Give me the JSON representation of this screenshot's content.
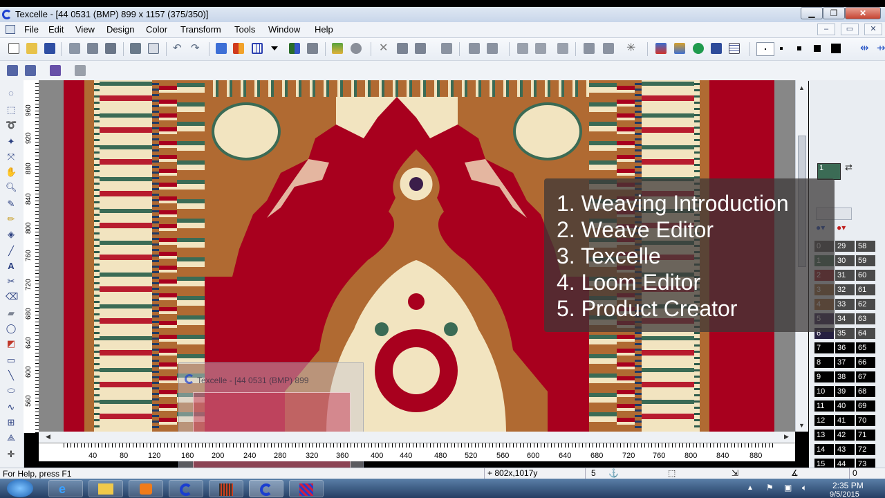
{
  "window": {
    "title": "Texcelle - [44 0531 (BMP) 899 x 1157 (375/350)]",
    "min_label": "▁",
    "restore_label": "❐",
    "close_label": "✕"
  },
  "menu": [
    "File",
    "Edit",
    "View",
    "Design",
    "Color",
    "Transform",
    "Tools",
    "Window",
    "Help"
  ],
  "mdi_controls": [
    "–",
    "▭",
    "✕"
  ],
  "vruler_labels": [
    "960",
    "920",
    "880",
    "840",
    "800",
    "760",
    "720",
    "680",
    "640",
    "600",
    "560"
  ],
  "hruler_labels": [
    "40",
    "80",
    "120",
    "160",
    "200",
    "240",
    "280",
    "320",
    "360",
    "400",
    "440",
    "480",
    "520",
    "560",
    "600",
    "640",
    "680",
    "720",
    "760",
    "800",
    "840",
    "880"
  ],
  "overlay_items": [
    "1. Weaving Introduction",
    "2. Weave Editor",
    "3. Texcelle",
    "4. Loom Editor",
    "5. Product Creator"
  ],
  "thumbnail": {
    "title": "Texcelle - [44 0531 (BMP) 899"
  },
  "palette": {
    "swatch_label": "1",
    "col1": [
      "0",
      "1",
      "2",
      "3",
      "4",
      "5",
      "6",
      "7",
      "8",
      "9",
      "10",
      "11",
      "12",
      "13",
      "14",
      "15"
    ],
    "col2": [
      "29",
      "30",
      "31",
      "32",
      "33",
      "34",
      "35",
      "36",
      "37",
      "38",
      "39",
      "40",
      "41",
      "42",
      "43",
      "44"
    ],
    "col3": [
      "58",
      "59",
      "60",
      "61",
      "62",
      "63",
      "64",
      "65",
      "66",
      "67",
      "68",
      "69",
      "70",
      "71",
      "72",
      "73"
    ],
    "colors": [
      "#5b5b5b",
      "#4e7a60",
      "#a0202a",
      "#a4703e",
      "#a56b3b",
      "#3a2d5a",
      "#262041",
      "#000000",
      "#000000",
      "#000000",
      "#000000",
      "#000000",
      "#000000",
      "#000000",
      "#000000",
      "#000000"
    ]
  },
  "status": {
    "help": "For Help, press F1",
    "coords": "+ 802x,1017y",
    "value": "5",
    "right_value": "0"
  },
  "clock": {
    "time": "2:35 PM",
    "date": "9/5/2015"
  },
  "colors": {
    "rug_field": "#a8001e",
    "rug_border": "#b06a32",
    "rug_cream": "#f2e4c0",
    "accent_blue": "#1b3fd0"
  }
}
